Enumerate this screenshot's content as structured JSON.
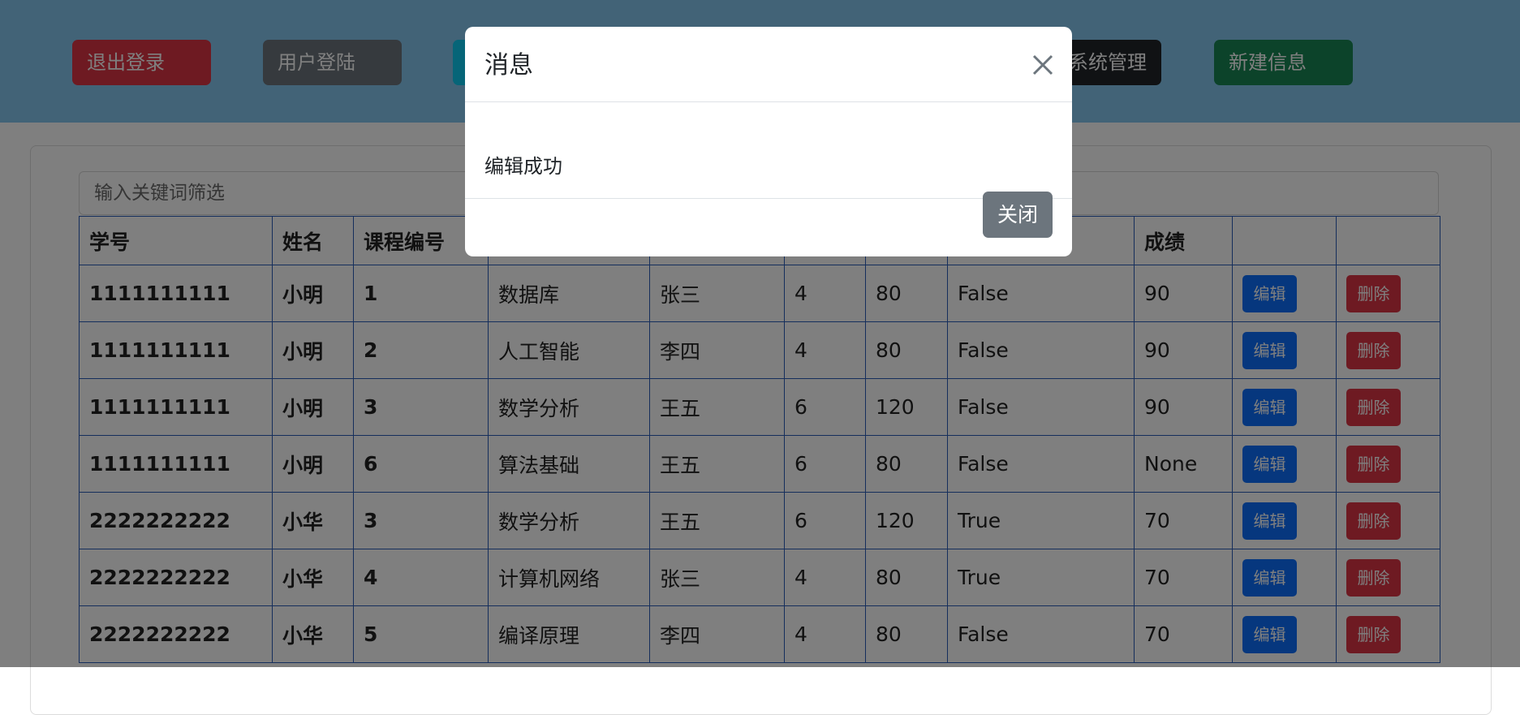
{
  "topbar": {
    "buttons": [
      {
        "label": "退出登录",
        "color": "#dc3545"
      },
      {
        "label": "用户登陆",
        "color": "#6c757d"
      },
      {
        "label": "",
        "color": "#0dcaf0"
      },
      {
        "label": "系统管理",
        "color": "#212529"
      },
      {
        "label": "新建信息",
        "color": "#198754"
      }
    ]
  },
  "filter": {
    "placeholder": "输入关键词筛选"
  },
  "table": {
    "headers": [
      "学号",
      "姓名",
      "课程编号",
      "",
      "",
      "",
      "",
      "",
      "成绩",
      "",
      ""
    ],
    "edit_label": "编辑",
    "delete_label": "删除",
    "rows": [
      [
        "1111111111",
        "小明",
        "1",
        "数据库",
        "张三",
        "4",
        "80",
        "False",
        "90"
      ],
      [
        "1111111111",
        "小明",
        "2",
        "人工智能",
        "李四",
        "4",
        "80",
        "False",
        "90"
      ],
      [
        "1111111111",
        "小明",
        "3",
        "数学分析",
        "王五",
        "6",
        "120",
        "False",
        "90"
      ],
      [
        "1111111111",
        "小明",
        "6",
        "算法基础",
        "王五",
        "6",
        "80",
        "False",
        "None"
      ],
      [
        "2222222222",
        "小华",
        "3",
        "数学分析",
        "王五",
        "6",
        "120",
        "True",
        "70"
      ],
      [
        "2222222222",
        "小华",
        "4",
        "计算机网络",
        "张三",
        "4",
        "80",
        "True",
        "70"
      ],
      [
        "2222222222",
        "小华",
        "5",
        "编译原理",
        "李四",
        "4",
        "80",
        "False",
        "70"
      ]
    ]
  },
  "modal": {
    "title": "消息",
    "message": "编辑成功",
    "close_label": "关闭",
    "close_icon": "close-icon"
  }
}
